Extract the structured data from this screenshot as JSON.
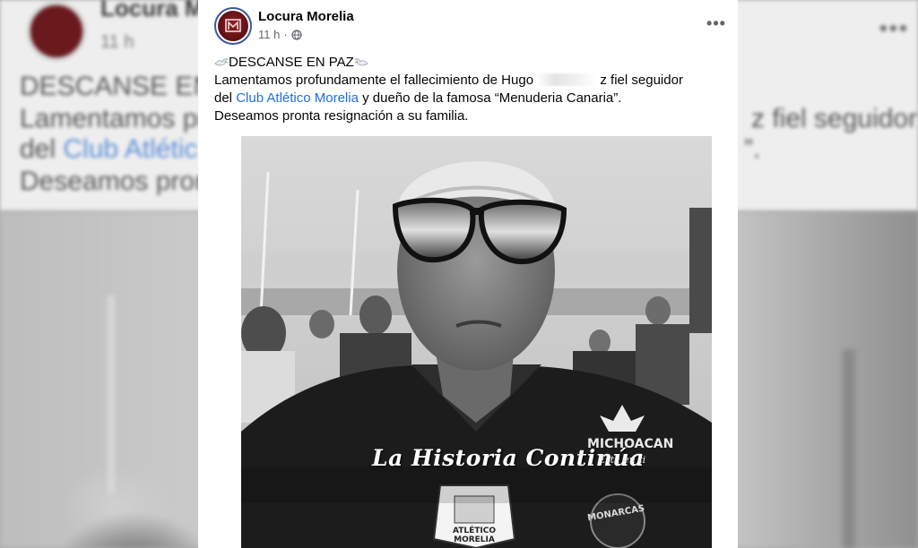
{
  "post": {
    "page_name": "Locura Morelia",
    "time": "11 h",
    "time_separator": "·",
    "privacy_icon": "globe-icon",
    "more_icon": "more-options-icon",
    "more_label": "•••",
    "text": {
      "line1": "DESCANSE EN PAZ",
      "line2_prefix": "Lamentamos profundamente el fallecimiento de Hugo",
      "line2_suffix": "z fiel seguidor",
      "line3_prefix": "del",
      "line3_link": "Club Atlético Morelia",
      "line3_suffix": "y dueño de la famosa “Menuderia Canaria”.",
      "line4": "Deseamos pronta resignación a su familia."
    },
    "photo": {
      "caption": "La Historia Continúa",
      "jersey_brand": "MICHOACAN",
      "jersey_slogan": "Está en ti",
      "crest_text": "ATLÉTICO MORELIA",
      "team_text": "MONARCAS"
    }
  },
  "background": {
    "page_name": "Locura M",
    "time": "11 h",
    "line1": "DESCANSE EN",
    "line2_left": "Lamentamos pro",
    "line2_right": "z fiel seguidor",
    "line3_prefix": "del",
    "line3_link": "Club Atlétic",
    "line3_right": "”.",
    "line4": "Deseamos pron"
  },
  "colors": {
    "link": "#216fdb",
    "brand": "#6a1a1d",
    "text": "#050505",
    "meta": "#65676b"
  }
}
